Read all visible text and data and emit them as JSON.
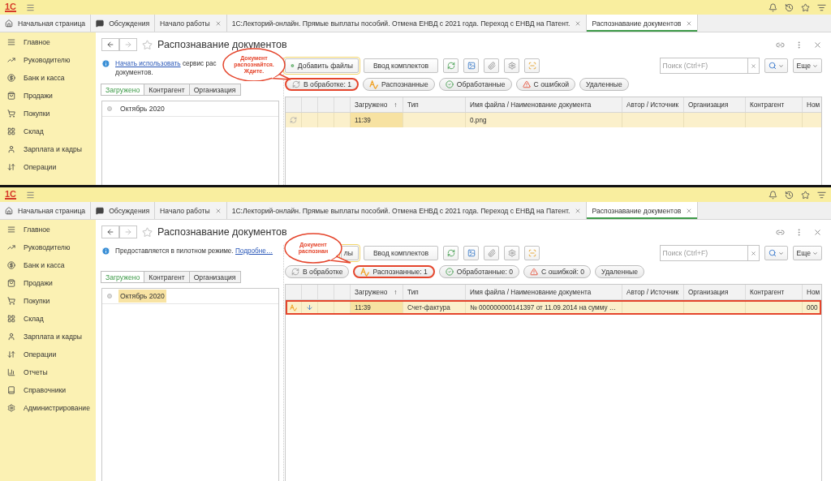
{
  "screens": [
    {
      "header": {
        "logo": "1С"
      },
      "tabs": [
        {
          "label": "Начальная страница",
          "selected": false,
          "closable": false
        },
        {
          "label": "Обсуждения",
          "selected": false,
          "closable": false
        },
        {
          "label": "Начало работы",
          "selected": false,
          "closable": true
        },
        {
          "label": "1С:Лекторий-онлайн. Прямые выплаты пособий. Отмена ЕНВД с 2021 года. Переход с ЕНВД на Патент.",
          "selected": false,
          "closable": true
        },
        {
          "label": "Распознавание документов",
          "selected": true,
          "closable": true
        }
      ],
      "sidebar": {
        "items": [
          "Главное",
          "Руководителю",
          "Банк и касса",
          "Продажи",
          "Покупки",
          "Склад",
          "Зарплата и кадры",
          "Операции"
        ]
      },
      "form": {
        "title": "Распознавание документов",
        "info": {
          "lines": [
            [
              {
                "text": "Начать использовать",
                "link": true
              },
              {
                "text": " сервис рас",
                "link": false
              }
            ],
            [
              {
                "text": "документов.",
                "link": false
              }
            ]
          ]
        },
        "filter_tabs": [
          {
            "label": "Загружено",
            "selected": true
          },
          {
            "label": "Контрагент",
            "selected": false
          },
          {
            "label": "Организация",
            "selected": false
          }
        ],
        "tree": [
          {
            "label": "Октябрь 2020",
            "selected": false
          }
        ],
        "toolbar": {
          "add_button": {
            "label": "Добавить файлы",
            "icon": true
          },
          "kit_button": "Ввод комплектов",
          "search": {
            "placeholder": "Поиск (Ctrl+F)"
          },
          "more_button": "Еще"
        },
        "chips": [
          {
            "kind": "sync",
            "label": "В обработке: 1",
            "highlighted": true
          },
          {
            "kind": "recognized",
            "label": "Распознанные",
            "highlighted": false
          },
          {
            "kind": "check",
            "label": "Обработанные",
            "highlighted": false
          },
          {
            "kind": "warning",
            "label": "С ошибкой",
            "highlighted": false
          },
          {
            "kind": "plain",
            "label": "Удаленные",
            "highlighted": false
          }
        ],
        "table": {
          "columns": [
            {
              "label": "Загружено",
              "sort": "↑"
            },
            {
              "label": "Тип"
            },
            {
              "label": "Имя файла / Наименование документа"
            },
            {
              "label": "Автор / Источник"
            },
            {
              "label": "Организация"
            },
            {
              "label": "Контрагент"
            },
            {
              "label": "Ном"
            }
          ],
          "rows": [
            {
              "kind": "processing",
              "downloaded": false,
              "selected": true,
              "highlighted": false,
              "cells": [
                "11:39",
                null,
                "0.png",
                null,
                null,
                null,
                null
              ]
            }
          ]
        }
      },
      "callout": {
        "lines": [
          "Документ",
          "распознайтся.",
          "Ждите."
        ]
      }
    },
    {
      "header": {
        "logo": "1С"
      },
      "tabs": [
        {
          "label": "Начальная страница",
          "selected": false,
          "closable": false
        },
        {
          "label": "Обсуждения",
          "selected": false,
          "closable": false
        },
        {
          "label": "Начало работы",
          "selected": false,
          "closable": true
        },
        {
          "label": "1С:Лекторий-онлайн. Прямые выплаты пособий. Отмена ЕНВД с 2021 года. Переход с ЕНВД на Патент.",
          "selected": false,
          "closable": true
        },
        {
          "label": "Распознавание документов",
          "selected": true,
          "closable": true
        }
      ],
      "sidebar": {
        "items": [
          "Главное",
          "Руководителю",
          "Банк и касса",
          "Продажи",
          "Покупки",
          "Склад",
          "Зарплата и кадры",
          "Операции",
          "Отчеты",
          "Справочники",
          "Администрирование"
        ]
      },
      "form": {
        "title": "Распознавание документов",
        "info": {
          "lines": [
            [
              {
                "text": "Предоставляется в пилотном режиме. ",
                "link": false
              },
              {
                "text": "Подробне…",
                "link": true
              }
            ]
          ]
        },
        "filter_tabs": [
          {
            "label": "Загружено",
            "selected": true
          },
          {
            "label": "Контрагент",
            "selected": false
          },
          {
            "label": "Организация",
            "selected": false
          }
        ],
        "tree": [
          {
            "label": "Октябрь 2020",
            "selected": true
          }
        ],
        "toolbar": {
          "add_button": {
            "label": "лы",
            "icon": false
          },
          "kit_button": "Ввод комплектов",
          "search": {
            "placeholder": "Поиск (Ctrl+F)"
          },
          "more_button": "Еще"
        },
        "chips": [
          {
            "kind": "sync",
            "label": "В обработке",
            "highlighted": false
          },
          {
            "kind": "recognized",
            "label": "Распознанные: 1",
            "highlighted": true
          },
          {
            "kind": "check",
            "label": "Обработанные: 0",
            "highlighted": false
          },
          {
            "kind": "warning",
            "label": "С ошибкой: 0",
            "highlighted": false
          },
          {
            "kind": "plain",
            "label": "Удаленные",
            "highlighted": false
          }
        ],
        "table": {
          "columns": [
            {
              "label": "Загружено",
              "sort": "↑"
            },
            {
              "label": "Тип"
            },
            {
              "label": "Имя файла / Наименование документа"
            },
            {
              "label": "Автор / Источник"
            },
            {
              "label": "Организация"
            },
            {
              "label": "Контрагент"
            },
            {
              "label": "Ном"
            }
          ],
          "rows": [
            {
              "kind": "recognized",
              "downloaded": true,
              "selected": true,
              "highlighted": true,
              "cells": [
                "11:39",
                "Счет-фактура",
                "№ 000000000141397 от 11.09.2014 на сумму …",
                null,
                null,
                null,
                "000"
              ]
            }
          ]
        }
      },
      "callout": {
        "lines": [
          "Документ",
          "распознан"
        ]
      }
    }
  ]
}
